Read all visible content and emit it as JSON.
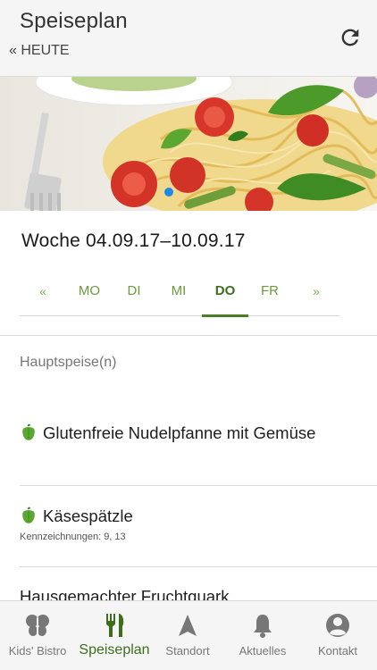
{
  "header": {
    "title": "Speiseplan",
    "back_label": "« HEUTE",
    "refresh_icon": "refresh-icon"
  },
  "week": {
    "label": "Woche 04.09.17–10.09.17"
  },
  "day_tabs": {
    "prev": "«",
    "days": [
      "MO",
      "DI",
      "MI",
      "DO",
      "FR"
    ],
    "next": "»",
    "active": "DO"
  },
  "section": {
    "label": "Hauptspeise(n)"
  },
  "dishes": [
    {
      "name": "Glutenfreie Nudelpfanne mit Gemüse",
      "icon": "vegetarian-pepper-icon",
      "note": ""
    },
    {
      "name": "Käsespätzle",
      "icon": "vegetarian-pepper-icon",
      "note": "Kennzeichnungen: 9, 13"
    },
    {
      "name": "Hausgemachter Fruchtquark",
      "icon": "",
      "note": ""
    }
  ],
  "nav": {
    "items": [
      {
        "label": "Kids' Bistro",
        "icon": "butterfly-icon"
      },
      {
        "label": "Speiseplan",
        "icon": "fork-knife-icon"
      },
      {
        "label": "Standort",
        "icon": "navigation-arrow-icon"
      },
      {
        "label": "Aktuelles",
        "icon": "bell-icon"
      },
      {
        "label": "Kontakt",
        "icon": "person-circle-icon"
      }
    ],
    "active": "Speiseplan"
  },
  "colors": {
    "accent": "#3d6e1e",
    "tab_inactive": "#6a9a3a",
    "header_bg": "#f5f5f5",
    "pager_dot": "#1e88e5"
  }
}
